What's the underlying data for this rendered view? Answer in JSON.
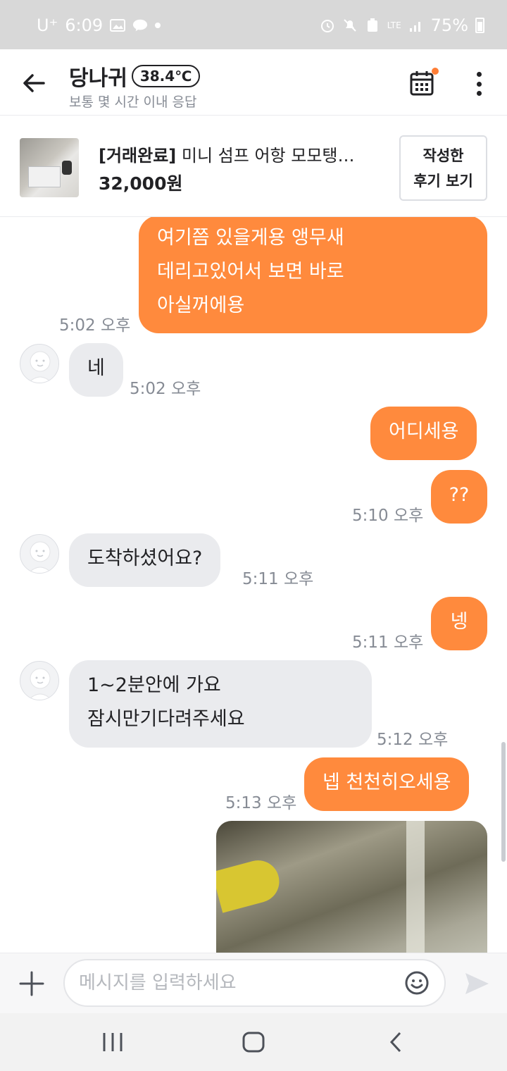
{
  "status_bar": {
    "carrier": "U⁺",
    "time": "6:09",
    "network": "LTE",
    "battery": "75%"
  },
  "header": {
    "title": "당나귀",
    "temperature": "38.4℃",
    "subtitle": "보통 몇 시간 이내 응답",
    "icons": [
      "back-arrow-icon",
      "calendar-icon",
      "more-vertical-icon"
    ],
    "accent_color": "#ff7e36"
  },
  "product": {
    "status": "[거래완료]",
    "title": " 미니 섬프 어항 모모탱…",
    "price": "32,000원",
    "review_button": "작성한\n후기 보기"
  },
  "messages": [
    {
      "from": "me",
      "lines": "여기쯤 있을게용 앵무새\n데리고있어서 보면 바로\n아실꺼에용",
      "time": "5:02 오후"
    },
    {
      "from": "them",
      "lines": "네",
      "time": "5:02 오후"
    },
    {
      "from": "me",
      "lines": "어디세용",
      "time": ""
    },
    {
      "from": "me",
      "lines": "??",
      "time": "5:10 오후"
    },
    {
      "from": "them",
      "lines": "도착하셨어요?",
      "time": "5:11 오후"
    },
    {
      "from": "me",
      "lines": "넹",
      "time": "5:11 오후"
    },
    {
      "from": "them",
      "lines": "1~2분안에 가요\n잠시만기다려주세요",
      "time": "5:12 오후"
    },
    {
      "from": "me",
      "lines": "넵 천천히오세용",
      "time": "5:13 오후"
    },
    {
      "from": "me",
      "type": "image"
    }
  ],
  "colors": {
    "my_bubble": "#ff8a3d",
    "their_bubble": "#eaebee",
    "time_text": "#868b94"
  },
  "input": {
    "placeholder": "메시지를 입력하세요",
    "icons": [
      "plus-icon",
      "emoji-icon",
      "send-icon"
    ]
  },
  "nav": {
    "icons": [
      "recent-apps-icon",
      "home-icon",
      "back-icon"
    ]
  }
}
